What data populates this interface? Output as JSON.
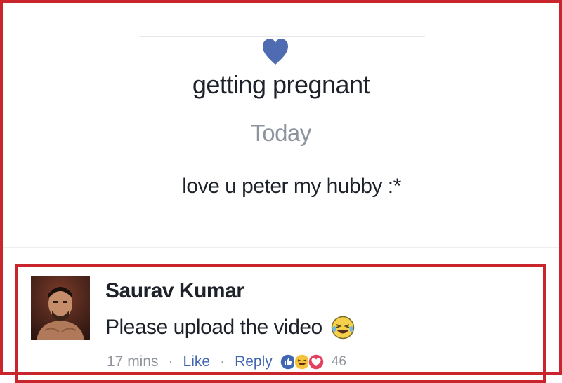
{
  "post": {
    "life_event_title": "getting pregnant",
    "date": "Today",
    "message": "love u peter my hubby :*"
  },
  "comment": {
    "author": "Saurav Kumar",
    "text": "Please upload the video",
    "time": "17 mins",
    "like_label": "Like",
    "reply_label": "Reply",
    "reaction_count": "46",
    "reactions": [
      "like-icon",
      "haha-icon",
      "love-icon"
    ]
  },
  "colors": {
    "highlight_border": "#c8262c",
    "heart": "#4f6bb1",
    "link": "#4267b2",
    "muted": "#90949c"
  }
}
